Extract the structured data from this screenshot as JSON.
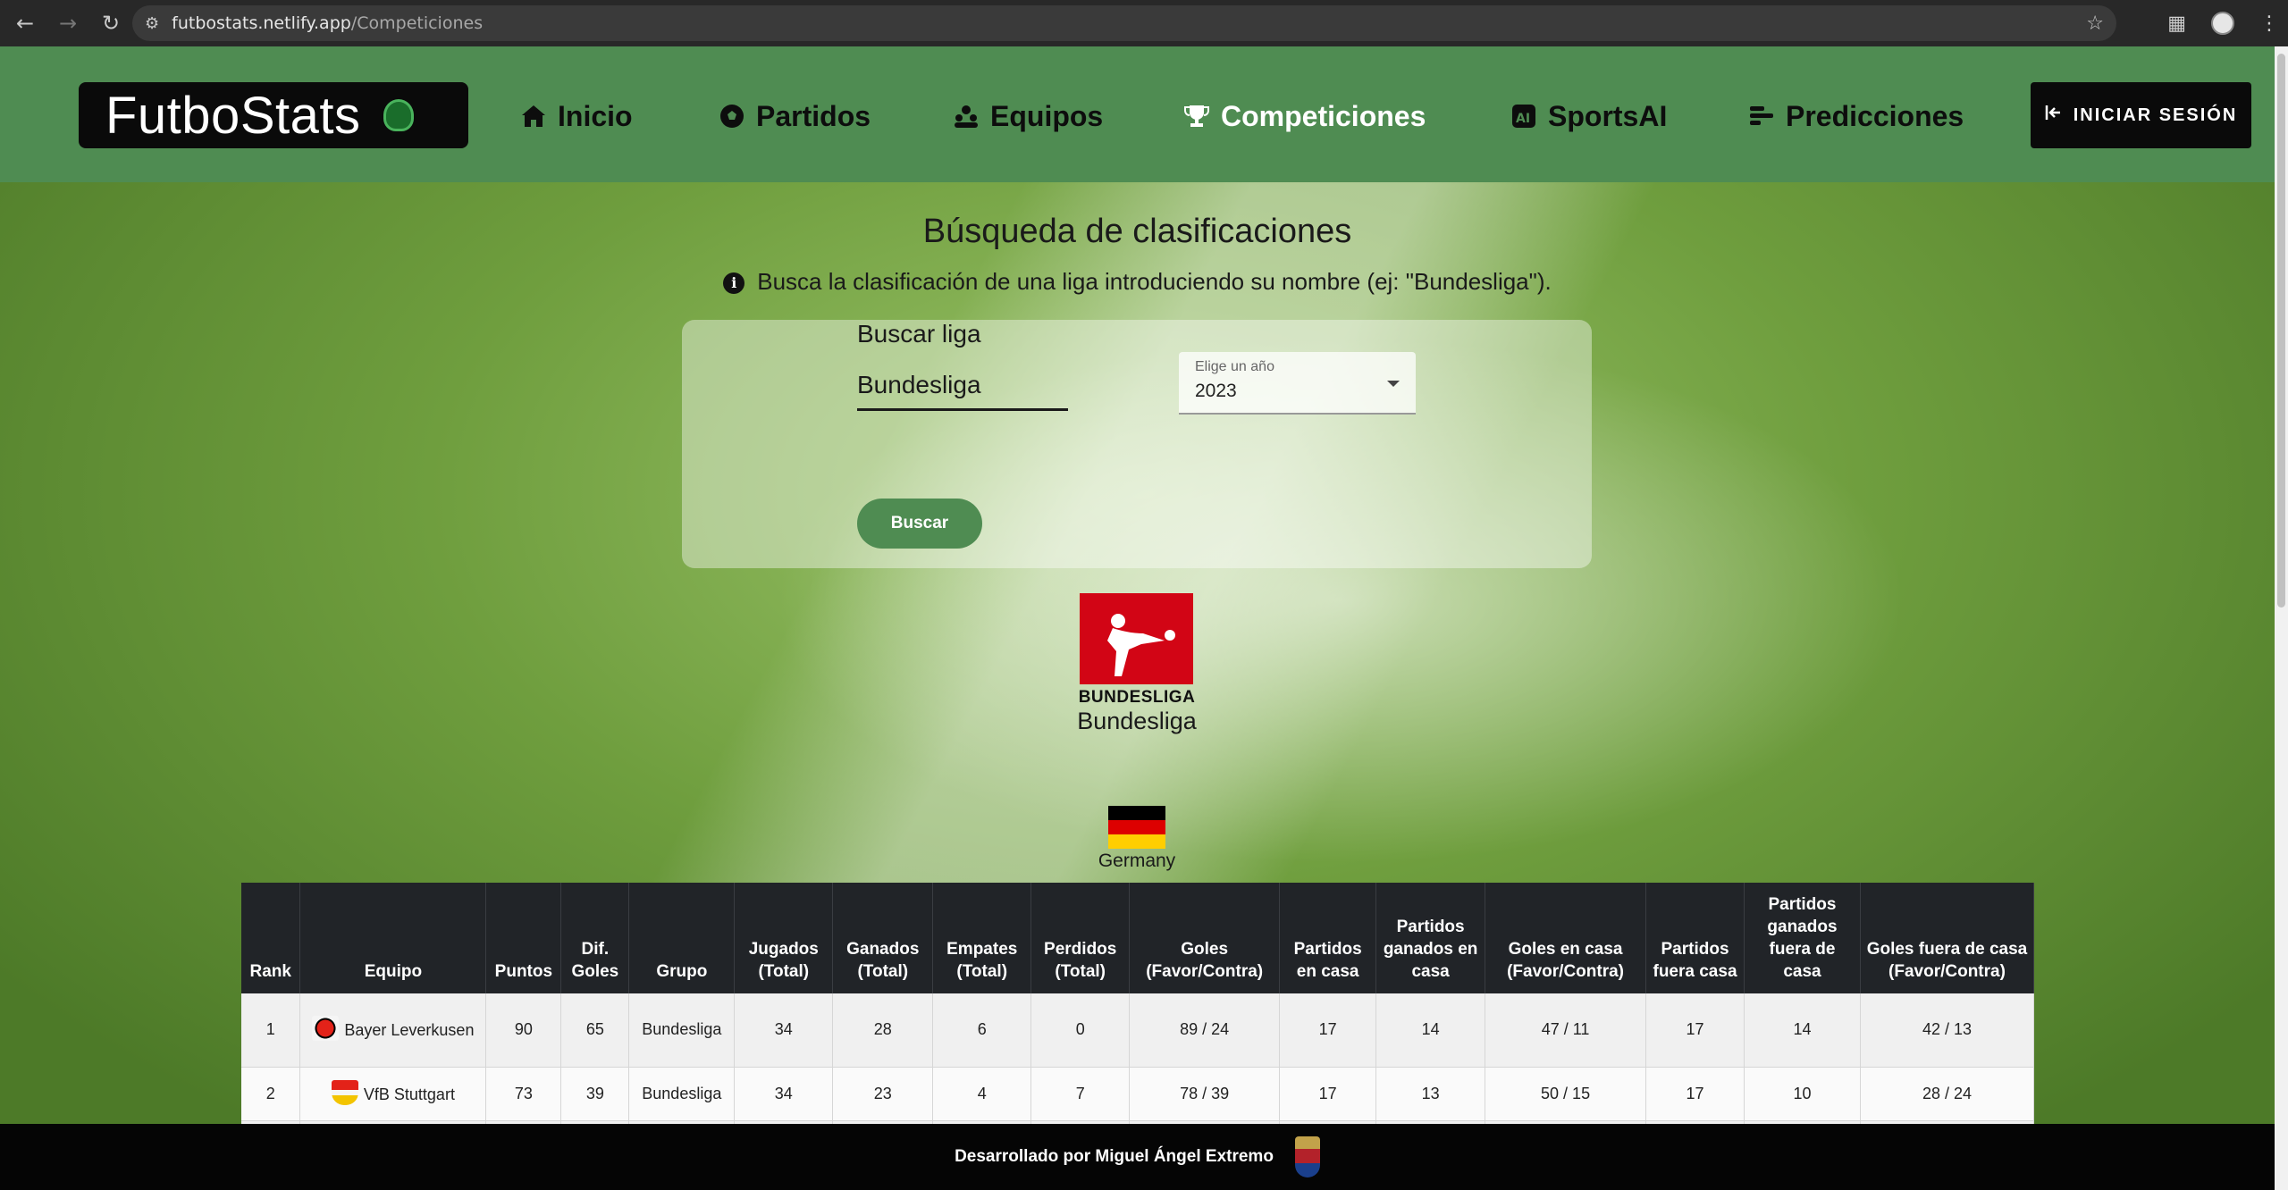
{
  "browser": {
    "url_domain": "futbostats.netlify.app",
    "url_path": "/Competiciones"
  },
  "navbar": {
    "brand": "FutboStats",
    "items": [
      {
        "label": "Inicio",
        "icon": "home-icon"
      },
      {
        "label": "Partidos",
        "icon": "soccer-ball-icon"
      },
      {
        "label": "Equipos",
        "icon": "users-icon"
      },
      {
        "label": "Competiciones",
        "icon": "trophy-icon"
      },
      {
        "label": "SportsAI",
        "icon": "ai-icon"
      },
      {
        "label": "Predicciones",
        "icon": "chart-bars-icon"
      }
    ],
    "active": "Competiciones",
    "login_label": "INICIAR SESIÓN"
  },
  "search": {
    "title": "Búsqueda de clasificaciones",
    "info": "Busca la clasificación de una liga introduciendo su nombre (ej: \"Bundesliga\").",
    "league_label": "Buscar liga",
    "league_value": "Bundesliga",
    "year_label": "Elige un año",
    "year_value": "2023",
    "button_label": "Buscar"
  },
  "league": {
    "logo_text": "BUNDESLIGA",
    "name": "Bundesliga",
    "country": "Germany",
    "flag_colors": [
      "#000000",
      "#dd0000",
      "#ffce00"
    ]
  },
  "table": {
    "headers": [
      "Rank",
      "Equipo",
      "Puntos",
      "Dif. Goles",
      "Grupo",
      "Jugados (Total)",
      "Ganados (Total)",
      "Empates (Total)",
      "Perdidos (Total)",
      "Goles (Favor/Contra)",
      "Partidos en casa",
      "Partidos ganados en casa",
      "Goles en casa (Favor/Contra)",
      "Partidos fuera casa",
      "Partidos ganados fuera de casa",
      "Goles fuera de casa (Favor/Contra)"
    ],
    "rows": [
      {
        "rank": "1",
        "team": "Bayer Leverkusen",
        "points": "90",
        "goal_diff": "65",
        "group": "Bundesliga",
        "played": "34",
        "won": "28",
        "draws": "6",
        "lost": "0",
        "goals": "89 / 24",
        "home_played": "17",
        "home_won": "14",
        "home_goals": "47 / 11",
        "away_played": "17",
        "away_won": "14",
        "away_goals": "42 / 13"
      },
      {
        "rank": "2",
        "team": "VfB Stuttgart",
        "points": "73",
        "goal_diff": "39",
        "group": "Bundesliga",
        "played": "34",
        "won": "23",
        "draws": "4",
        "lost": "7",
        "goals": "78 / 39",
        "home_played": "17",
        "home_won": "13",
        "home_goals": "50 / 15",
        "away_played": "17",
        "away_won": "10",
        "away_goals": "28 / 24"
      }
    ]
  },
  "footer": {
    "text": "Desarrollado por Miguel Ángel Extremo"
  }
}
